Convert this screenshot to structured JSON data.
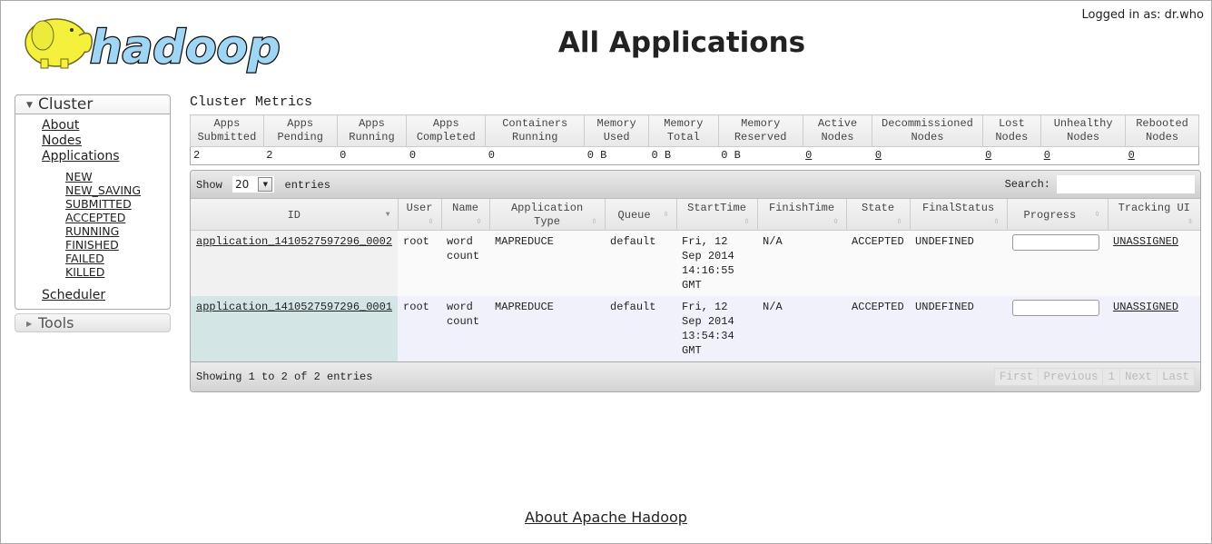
{
  "header": {
    "logo_text": "hadoop",
    "title": "All Applications",
    "logged_in": "Logged in as: dr.who"
  },
  "sidebar": {
    "cluster_label": "Cluster",
    "links": [
      {
        "label": "About"
      },
      {
        "label": "Nodes"
      },
      {
        "label": "Applications"
      }
    ],
    "app_states": [
      "NEW",
      "NEW_SAVING",
      "SUBMITTED",
      "ACCEPTED",
      "RUNNING",
      "FINISHED",
      "FAILED",
      "KILLED"
    ],
    "scheduler_label": "Scheduler",
    "tools_label": "Tools"
  },
  "metrics": {
    "title": "Cluster Metrics",
    "headers": [
      [
        "Apps",
        "Submitted"
      ],
      [
        "Apps",
        "Pending"
      ],
      [
        "Apps",
        "Running"
      ],
      [
        "Apps",
        "Completed"
      ],
      [
        "Containers",
        "Running"
      ],
      [
        "Memory",
        "Used"
      ],
      [
        "Memory",
        "Total"
      ],
      [
        "Memory",
        "Reserved"
      ],
      [
        "Active",
        "Nodes"
      ],
      [
        "Decommissioned",
        "Nodes"
      ],
      [
        "Lost",
        "Nodes"
      ],
      [
        "Unhealthy",
        "Nodes"
      ],
      [
        "Rebooted",
        "Nodes"
      ]
    ],
    "values": [
      "2",
      "2",
      "0",
      "0",
      "0",
      "0 B",
      "0 B",
      "0 B",
      "0",
      "0",
      "0",
      "0",
      "0"
    ]
  },
  "datatable": {
    "show_label": "Show",
    "entries_label": "entries",
    "page_size": "20",
    "search_label": "Search:",
    "search_value": "",
    "columns": [
      "ID",
      "User",
      "Name",
      "Application Type",
      "Queue",
      "StartTime",
      "FinishTime",
      "State",
      "FinalStatus",
      "Progress",
      "Tracking UI"
    ],
    "rows": [
      {
        "id": "application_1410527597296_0002",
        "user": "root",
        "name": "word count",
        "type": "MAPREDUCE",
        "queue": "default",
        "start": "Fri, 12 Sep 2014 14:16:55 GMT",
        "finish": "N/A",
        "state": "ACCEPTED",
        "final_status": "UNDEFINED",
        "progress": 0,
        "tracking": "UNASSIGNED"
      },
      {
        "id": "application_1410527597296_0001",
        "user": "root",
        "name": "word count",
        "type": "MAPREDUCE",
        "queue": "default",
        "start": "Fri, 12 Sep 2014 13:54:34 GMT",
        "finish": "N/A",
        "state": "ACCEPTED",
        "final_status": "UNDEFINED",
        "progress": 0,
        "tracking": "UNASSIGNED"
      }
    ],
    "info": "Showing 1 to 2 of 2 entries",
    "pager": [
      "First",
      "Previous",
      "1",
      "Next",
      "Last"
    ]
  },
  "footer": {
    "link": "About Apache Hadoop"
  }
}
